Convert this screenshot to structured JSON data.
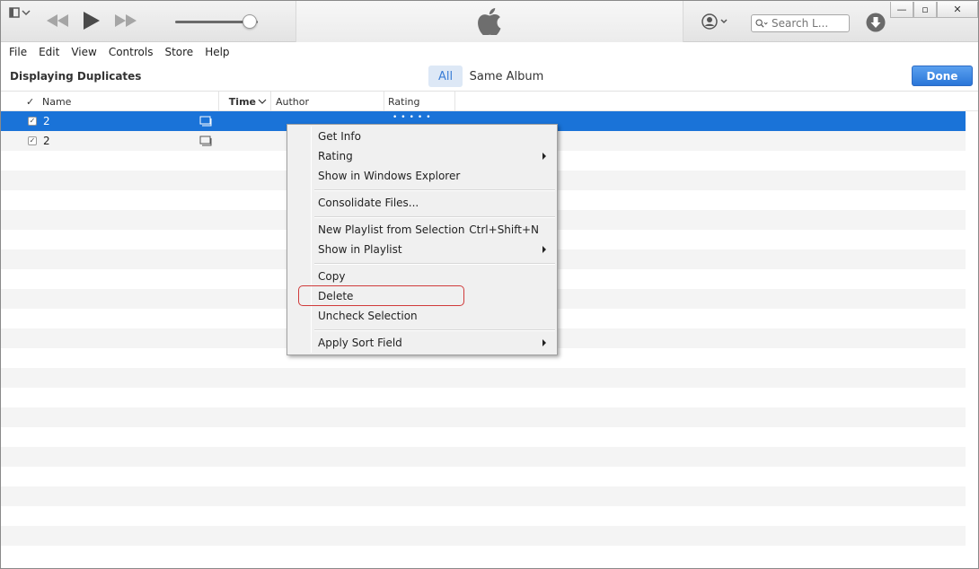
{
  "toolbar": {
    "search_placeholder": "Search L...",
    "volume_level": 0.9,
    "icons": {
      "mini_player": "mini-player-icon",
      "rewind": "rewind-icon",
      "play": "play-icon",
      "forward": "fast-forward-icon",
      "apple": "apple-logo-icon",
      "account": "account-icon",
      "search": "search-icon",
      "download": "download-icon"
    },
    "window_buttons": {
      "minimize": "—",
      "restore": "▫",
      "close": "✕"
    }
  },
  "menubar": {
    "items": [
      "File",
      "Edit",
      "View",
      "Controls",
      "Store",
      "Help"
    ]
  },
  "header": {
    "title": "Displaying Duplicates",
    "filters": [
      "All",
      "Same Album"
    ],
    "selected_filter": "All",
    "done_label": "Done"
  },
  "columns": {
    "check": "✓",
    "name": "Name",
    "time": "Time",
    "author": "Author",
    "rating": "Rating"
  },
  "rows": [
    {
      "checked": "✓",
      "name": "2",
      "selected": true
    },
    {
      "checked": "✓",
      "name": "2",
      "selected": false
    }
  ],
  "context_menu": {
    "items": {
      "get_info": "Get Info",
      "rating": "Rating",
      "show_explorer": "Show in Windows Explorer",
      "consolidate": "Consolidate Files...",
      "new_playlist": "New Playlist from Selection",
      "new_playlist_shortcut": "Ctrl+Shift+N",
      "show_in_playlist": "Show in Playlist",
      "copy": "Copy",
      "delete": "Delete",
      "uncheck": "Uncheck Selection",
      "apply_sort": "Apply Sort Field"
    }
  },
  "colors": {
    "selection": "#1a73d8",
    "done_button": "#2a76d8",
    "highlight_outline": "#d03a3a"
  }
}
